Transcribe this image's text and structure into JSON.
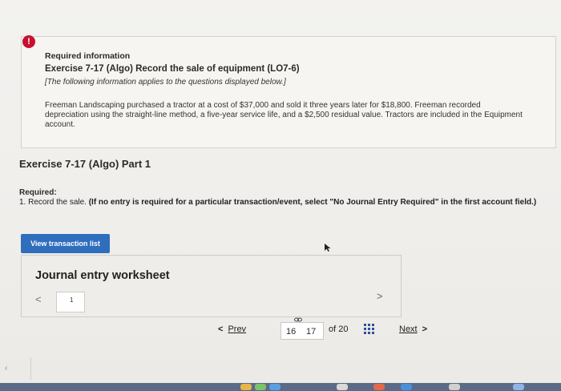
{
  "alert_symbol": "!",
  "info": {
    "heading": "Required information",
    "exercise_title": "Exercise 7-17 (Algo) Record the sale of equipment (LO7-6)",
    "note": "[The following information applies to the questions displayed below.]",
    "paragraph": "Freeman Landscaping purchased a tractor at a cost of $37,000 and sold it three years later for $18,800. Freeman recorded depreciation using the straight-line method, a five-year service life, and a $2,500 residual value. Tractors are included in the Equipment account."
  },
  "part_title": "Exercise 7-17 (Algo) Part 1",
  "required": {
    "label": "Required:",
    "text_plain": "1. Record the sale. ",
    "text_bold": "(If no entry is required for a particular transaction/event, select \"No Journal Entry Required\" in the first account field.)"
  },
  "view_transaction_label": "View transaction list",
  "journal": {
    "title": "Journal entry worksheet",
    "prev_symbol": "<",
    "current_page": "1",
    "next_symbol": ">"
  },
  "pager": {
    "prev_label": "Prev",
    "prev_arrow": "<",
    "current": "16",
    "next_num": "17",
    "of_label": "of 20",
    "next_label": "Next",
    "next_arrow": ">"
  },
  "colors": {
    "alert": "#c8102e",
    "primary_button": "#2f6ebd",
    "grid_icon": "#2f4f9a"
  }
}
